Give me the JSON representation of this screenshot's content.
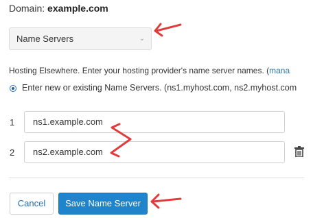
{
  "domain": {
    "label": "Domain:",
    "value": "example.com"
  },
  "dropdown": {
    "selected": "Name Servers",
    "icon": "chevron-down-icon"
  },
  "hosting": {
    "text": "Hosting Elsewhere. Enter your hosting provider's name server names. (",
    "link": "mana"
  },
  "radio": {
    "label": "Enter new or existing Name Servers. (ns1.myhost.com, ns2.myhost.com"
  },
  "name_servers": [
    {
      "index": "1",
      "value": "ns1.example.com"
    },
    {
      "index": "2",
      "value": "ns2.example.com"
    }
  ],
  "buttons": {
    "cancel": "Cancel",
    "save": "Save Name Server"
  },
  "colors": {
    "accent": "#1f84cc",
    "link": "#2a7ab0",
    "annotation": "#e03c3c"
  }
}
